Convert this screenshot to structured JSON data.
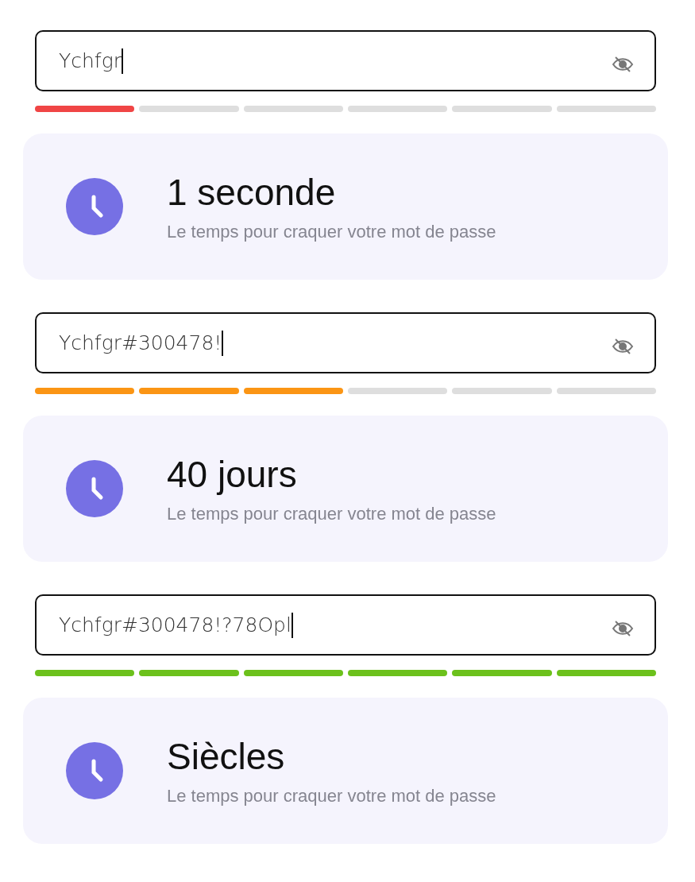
{
  "sections": [
    {
      "password": "Ychfgr",
      "color": "#f04545",
      "segments": [
        {
          "filled": true
        },
        {
          "filled": false
        },
        {
          "filled": false
        },
        {
          "filled": false
        },
        {
          "filled": false
        },
        {
          "filled": false
        }
      ],
      "time": "1 seconde",
      "caption": "Le temps pour craquer votre mot de passe"
    },
    {
      "password": "Ychfgr#300478!",
      "color": "#fb9514",
      "segments": [
        {
          "filled": true
        },
        {
          "filled": true
        },
        {
          "filled": true
        },
        {
          "filled": false
        },
        {
          "filled": false
        },
        {
          "filled": false
        }
      ],
      "time": "40 jours",
      "caption": "Le temps pour craquer votre mot de passe"
    },
    {
      "password": "Ychfgr#300478!?78Opl",
      "color": "#6cc11c",
      "segments": [
        {
          "filled": true
        },
        {
          "filled": true
        },
        {
          "filled": true
        },
        {
          "filled": true
        },
        {
          "filled": true
        },
        {
          "filled": true
        }
      ],
      "time": "Siècles",
      "caption": "Le temps pour craquer votre mot de passe"
    }
  ]
}
